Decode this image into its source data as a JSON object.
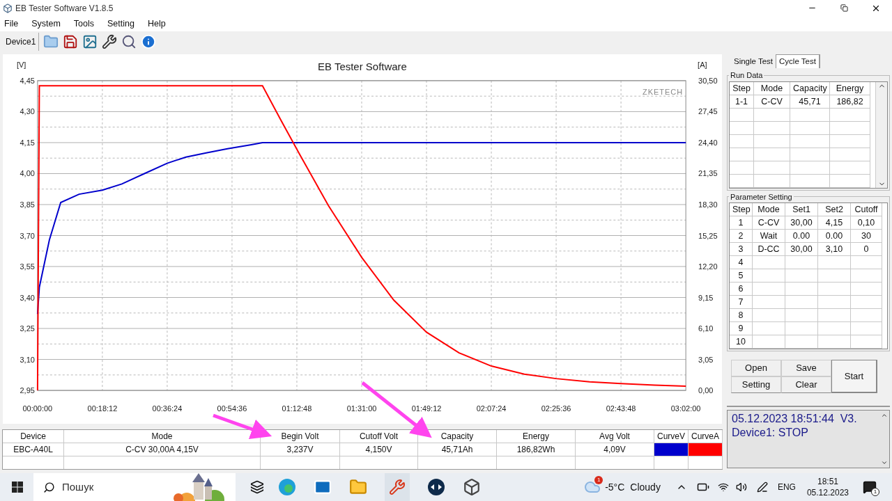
{
  "window": {
    "title": "EB Tester Software V1.8.5"
  },
  "menu": [
    "File",
    "System",
    "Tools",
    "Setting",
    "Help"
  ],
  "toolbar": {
    "device_tab": "Device1"
  },
  "chart": {
    "brand": "ZKETECH",
    "chart_data": {
      "type": "line",
      "grid": true,
      "title": "EB Tester Software",
      "ylabel": "[V]",
      "y2label": "[A]",
      "x": [
        0,
        30,
        200,
        390,
        700,
        1092,
        1420,
        1800,
        2184,
        2500,
        2840,
        3200,
        3600,
        3789,
        4100,
        4420,
        4900,
        5460,
        6000,
        6552,
        7100,
        7644,
        8200,
        8736,
        9300,
        9828,
        10400,
        10920
      ],
      "xlim": [
        0,
        10920
      ],
      "xticks": [
        {
          "value": 0,
          "label": "00:00:00"
        },
        {
          "value": 1092,
          "label": "00:18:12"
        },
        {
          "value": 2184,
          "label": "00:36:24"
        },
        {
          "value": 3276,
          "label": "00:54:36"
        },
        {
          "value": 4368,
          "label": "01:12:48"
        },
        {
          "value": 5460,
          "label": "01:31:00"
        },
        {
          "value": 6552,
          "label": "01:49:12"
        },
        {
          "value": 7644,
          "label": "02:07:24"
        },
        {
          "value": 8736,
          "label": "02:25:36"
        },
        {
          "value": 9828,
          "label": "02:43:48"
        },
        {
          "value": 10920,
          "label": "03:02:00"
        }
      ],
      "ylim": [
        2.95,
        4.45
      ],
      "yticks": [
        {
          "value": 2.95,
          "label": "2,95"
        },
        {
          "value": 3.1,
          "label": "3,10"
        },
        {
          "value": 3.25,
          "label": "3,25"
        },
        {
          "value": 3.4,
          "label": "3,40"
        },
        {
          "value": 3.55,
          "label": "3,55"
        },
        {
          "value": 3.7,
          "label": "3,70"
        },
        {
          "value": 3.85,
          "label": "3,85"
        },
        {
          "value": 4.0,
          "label": "4,00"
        },
        {
          "value": 4.15,
          "label": "4,15"
        },
        {
          "value": 4.3,
          "label": "4,30"
        },
        {
          "value": 4.45,
          "label": "4,45"
        }
      ],
      "y2lim": [
        0,
        30.5
      ],
      "y2ticks": [
        {
          "value": 0,
          "label": "0,00"
        },
        {
          "value": 3.05,
          "label": "3,05"
        },
        {
          "value": 6.1,
          "label": "6,10"
        },
        {
          "value": 9.15,
          "label": "9,15"
        },
        {
          "value": 12.2,
          "label": "12,20"
        },
        {
          "value": 15.25,
          "label": "15,25"
        },
        {
          "value": 18.3,
          "label": "18,30"
        },
        {
          "value": 21.35,
          "label": "21,35"
        },
        {
          "value": 24.4,
          "label": "24,40"
        },
        {
          "value": 27.45,
          "label": "27,45"
        },
        {
          "value": 30.5,
          "label": "30,50"
        }
      ],
      "series": [
        {
          "color": "#0000cc",
          "values": [
            3.32,
            3.45,
            3.68,
            3.86,
            3.9,
            3.92,
            3.95,
            4.0,
            4.05,
            4.08,
            4.1,
            4.12,
            4.14,
            4.15,
            4.15,
            4.15,
            4.15,
            4.15,
            4.15,
            4.15,
            4.15,
            4.15,
            4.15,
            4.15,
            4.15,
            4.15,
            4.15,
            4.15
          ]
        },
        {
          "color": "#ff0000",
          "axis": "y2",
          "values": [
            0,
            30,
            30,
            30,
            30,
            30,
            30,
            30,
            30,
            30,
            30,
            30,
            30,
            30,
            26.6,
            23.2,
            18.2,
            13.1,
            8.9,
            5.74,
            3.7,
            2.4,
            1.6,
            1.16,
            0.85,
            0.68,
            0.52,
            0.41
          ]
        }
      ]
    }
  },
  "summary": {
    "columns": [
      "Device",
      "Mode",
      "Begin Volt",
      "Cutoff Volt",
      "Capacity",
      "Energy",
      "Avg Volt",
      "CurveV",
      "CurveA"
    ],
    "row": [
      "EBC-A40L",
      "C-CV  30,00A  4,15V",
      "3,237V",
      "4,150V",
      "45,71Ah",
      "186,82Wh",
      "4,09V"
    ]
  },
  "side_tabs": [
    {
      "label": "Single Test",
      "selected": false
    },
    {
      "label": "Cycle Test",
      "selected": true
    }
  ],
  "run_data": {
    "title": "Run Data",
    "columns": [
      "Step",
      "Mode",
      "Capacity",
      "Energy"
    ],
    "rows": [
      [
        "1-1",
        "C-CV",
        "45,71",
        "186,82"
      ]
    ]
  },
  "parameter_setting": {
    "title": "Parameter Setting",
    "columns": [
      "Step",
      "Mode",
      "Set1",
      "Set2",
      "Cutoff"
    ],
    "rows": [
      [
        "1",
        "C-CV",
        "30,00",
        "4,15",
        "0,10"
      ],
      [
        "2",
        "Wait",
        "0.00",
        "0.00",
        "30"
      ],
      [
        "3",
        "D-CC",
        "30,00",
        "3,10",
        "0"
      ],
      [
        "4"
      ],
      [
        "5"
      ],
      [
        "6"
      ],
      [
        "7"
      ],
      [
        "8"
      ],
      [
        "9"
      ],
      [
        "10"
      ]
    ]
  },
  "buttons": {
    "open": "Open",
    "save": "Save",
    "setting": "Setting",
    "clear": "Clear",
    "start": "Start"
  },
  "log": [
    "05.12.2023 18:51:44  V3.",
    "Device1: STOP"
  ],
  "taskbar": {
    "search_placeholder": "Пошук",
    "weather_badge": "1",
    "temperature": "-5°C",
    "weather": "Cloudy",
    "language": "ENG",
    "time": "18:51",
    "date": "05.12.2023",
    "notification_badge": "1"
  }
}
